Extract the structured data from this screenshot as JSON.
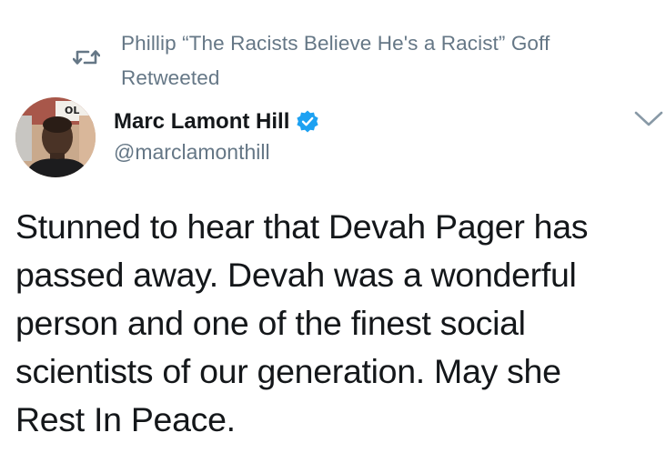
{
  "retweet": {
    "label_line1": "Phillip “The Racists Believe He's a Racist” Goff",
    "label_line2": "Retweeted",
    "icon": "retweet-icon"
  },
  "author": {
    "display_name": "Marc Lamont Hill",
    "handle": "@marclamonthill",
    "verified": true,
    "avatar_icon": "avatar"
  },
  "menu": {
    "icon": "chevron-down-icon"
  },
  "tweet": {
    "text": "Stunned to hear that Devah Pager has\npassed away. Devah was a wonderful\nperson and one of the finest social\nscientists of our generation. May she\nRest In Peace."
  },
  "colors": {
    "secondary_text": "#657786",
    "primary_text": "#14171a",
    "verified_blue": "#1da1f2"
  }
}
